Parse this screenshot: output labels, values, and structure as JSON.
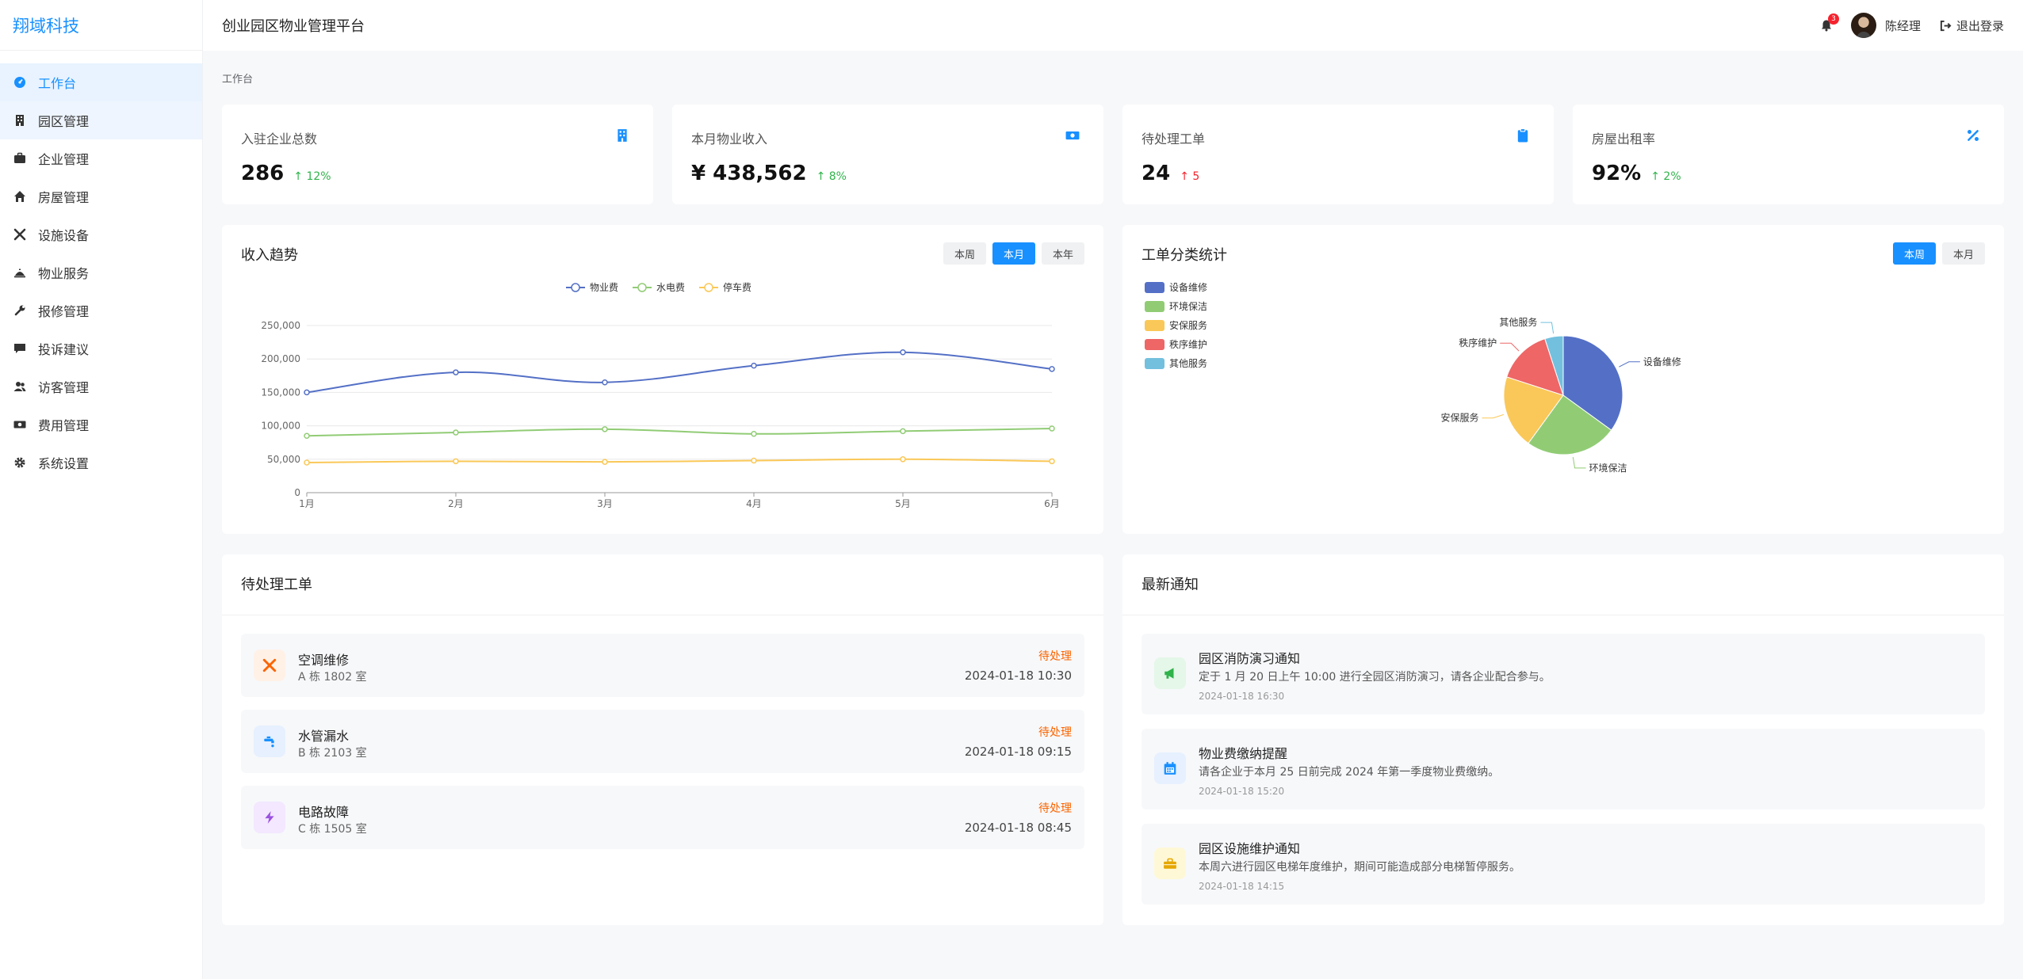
{
  "brand": "翔域科技",
  "header": {
    "title": "创业园区物业管理平台",
    "notification_count": "3",
    "user_name": "陈经理",
    "logout_label": "退出登录"
  },
  "sidebar": {
    "items": [
      {
        "label": "工作台",
        "icon": "dashboard-icon"
      },
      {
        "label": "园区管理",
        "icon": "building-icon"
      },
      {
        "label": "企业管理",
        "icon": "briefcase-icon"
      },
      {
        "label": "房屋管理",
        "icon": "home-icon"
      },
      {
        "label": "设施设备",
        "icon": "tools-icon"
      },
      {
        "label": "物业服务",
        "icon": "service-bell-icon"
      },
      {
        "label": "报修管理",
        "icon": "wrench-icon"
      },
      {
        "label": "投诉建议",
        "icon": "comment-icon"
      },
      {
        "label": "访客管理",
        "icon": "users-icon"
      },
      {
        "label": "费用管理",
        "icon": "money-icon"
      },
      {
        "label": "系统设置",
        "icon": "gear-icon"
      }
    ]
  },
  "breadcrumb": "工作台",
  "stats": [
    {
      "label": "入驻企业总数",
      "value": "286",
      "trend": "12%",
      "trend_direction": "up",
      "trend_color": "#2fb34a",
      "icon": "building-icon"
    },
    {
      "label": "本月物业收入",
      "value": "¥ 438,562",
      "trend": "8%",
      "trend_direction": "up",
      "trend_color": "#2fb34a",
      "icon": "money-icon"
    },
    {
      "label": "待处理工单",
      "value": "24",
      "trend": "5",
      "trend_direction": "up",
      "trend_color": "#f5222d",
      "icon": "clipboard-icon"
    },
    {
      "label": "房屋出租率",
      "value": "92%",
      "trend": "2%",
      "trend_direction": "up",
      "trend_color": "#2fb34a",
      "icon": "percent-icon"
    }
  ],
  "income_panel": {
    "title": "收入趋势",
    "ranges": [
      "本周",
      "本月",
      "本年"
    ],
    "active_range": "本月"
  },
  "workorder_panel": {
    "title": "工单分类统计",
    "ranges": [
      "本周",
      "本月"
    ],
    "active_range": "本周"
  },
  "chart_data": [
    {
      "type": "line",
      "categories": [
        "1月",
        "2月",
        "3月",
        "4月",
        "5月",
        "6月"
      ],
      "series": [
        {
          "name": "物业费",
          "values": [
            150000,
            180000,
            165000,
            190000,
            210000,
            185000
          ],
          "color": "#5470c6"
        },
        {
          "name": "水电费",
          "values": [
            85000,
            90000,
            95000,
            88000,
            92000,
            96000
          ],
          "color": "#91cc75"
        },
        {
          "name": "停车费",
          "values": [
            45000,
            47000,
            46000,
            48000,
            50000,
            47000
          ],
          "color": "#fac858"
        }
      ],
      "ylim": [
        0,
        250000
      ],
      "yticks": [
        "0",
        "50,000",
        "100,000",
        "150,000",
        "200,000",
        "250,000"
      ],
      "legend_position": "top-center",
      "grid": true
    },
    {
      "type": "pie",
      "slices": [
        {
          "name": "设备维修",
          "value": 35,
          "color": "#5470c6"
        },
        {
          "name": "环境保洁",
          "value": 25,
          "color": "#91cc75"
        },
        {
          "name": "安保服务",
          "value": 20,
          "color": "#fac858"
        },
        {
          "name": "秩序维护",
          "value": 15,
          "color": "#ee6666"
        },
        {
          "name": "其他服务",
          "value": 5,
          "color": "#73c0de"
        }
      ],
      "legend_position": "top-left"
    }
  ],
  "pending_panel": {
    "title": "待处理工单",
    "items": [
      {
        "title": "空调维修",
        "location": "A 栋 1802 室",
        "status": "待处理",
        "time": "2024-01-18 10:30",
        "icon": "tools-icon",
        "icon_color": "#fa6400",
        "icon_bg": "#fff1e6"
      },
      {
        "title": "水管漏水",
        "location": "B 栋 2103 室",
        "status": "待处理",
        "time": "2024-01-18 09:15",
        "icon": "faucet-icon",
        "icon_color": "#1890ff",
        "icon_bg": "#e6f0ff"
      },
      {
        "title": "电路故障",
        "location": "C 栋 1505 室",
        "status": "待处理",
        "time": "2024-01-18 08:45",
        "icon": "bolt-icon",
        "icon_color": "#9b51e0",
        "icon_bg": "#f3e8ff"
      }
    ]
  },
  "notice_panel": {
    "title": "最新通知",
    "items": [
      {
        "title": "园区消防演习通知",
        "content": "定于 1 月 20 日上午 10:00 进行全园区消防演习，请各企业配合参与。",
        "time": "2024-01-18 16:30",
        "icon": "megaphone-icon",
        "icon_color": "#2fb34a",
        "icon_bg": "#e4f7e8"
      },
      {
        "title": "物业费缴纳提醒",
        "content": "请各企业于本月 25 日前完成 2024 年第一季度物业费缴纳。",
        "time": "2024-01-18 15:20",
        "icon": "calendar-icon",
        "icon_color": "#1890ff",
        "icon_bg": "#e6f0ff"
      },
      {
        "title": "园区设施维护通知",
        "content": "本周六进行园区电梯年度维护，期间可能造成部分电梯暂停服务。",
        "time": "2024-01-18 14:15",
        "icon": "toolbox-icon",
        "icon_color": "#e6a700",
        "icon_bg": "#fff8d6"
      }
    ]
  }
}
